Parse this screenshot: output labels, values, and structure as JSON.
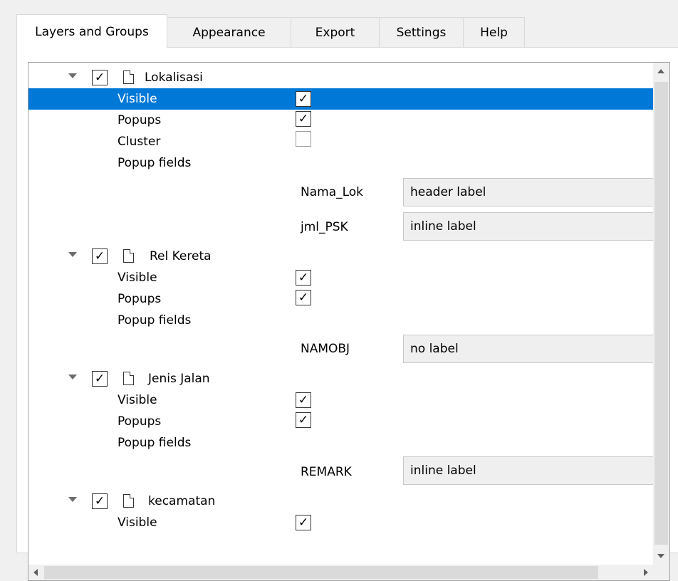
{
  "tabs": [
    "Layers and Groups",
    "Appearance",
    "Export",
    "Settings",
    "Help"
  ],
  "active_tab": "Layers and Groups",
  "tree": {
    "layers": [
      {
        "name": "Lokalisasi",
        "checked": true,
        "visible_label": "Visible",
        "visible": true,
        "popups_label": "Popups",
        "popups": true,
        "cluster_label": "Cluster",
        "cluster": false,
        "popup_fields_label": "Popup fields",
        "fields": [
          {
            "name": "Nama_Lok",
            "value": "header label"
          },
          {
            "name": "jml_PSK",
            "value": "inline label"
          }
        ]
      },
      {
        "name": "Rel Kereta",
        "checked": true,
        "visible_label": "Visible",
        "visible": true,
        "popups_label": "Popups",
        "popups": true,
        "popup_fields_label": "Popup fields",
        "fields": [
          {
            "name": "NAMOBJ",
            "value": "no label"
          }
        ]
      },
      {
        "name": "Jenis Jalan",
        "checked": true,
        "visible_label": "Visible",
        "visible": true,
        "popups_label": "Popups",
        "popups": true,
        "popup_fields_label": "Popup fields",
        "fields": [
          {
            "name": "REMARK",
            "value": "inline label"
          }
        ]
      },
      {
        "name": "kecamatan",
        "checked": true,
        "visible_label": "Visible",
        "visible": true
      }
    ]
  },
  "colors": {
    "selection": "#0078d7",
    "background": "#f0f0f0"
  },
  "check_glyph": "✓"
}
